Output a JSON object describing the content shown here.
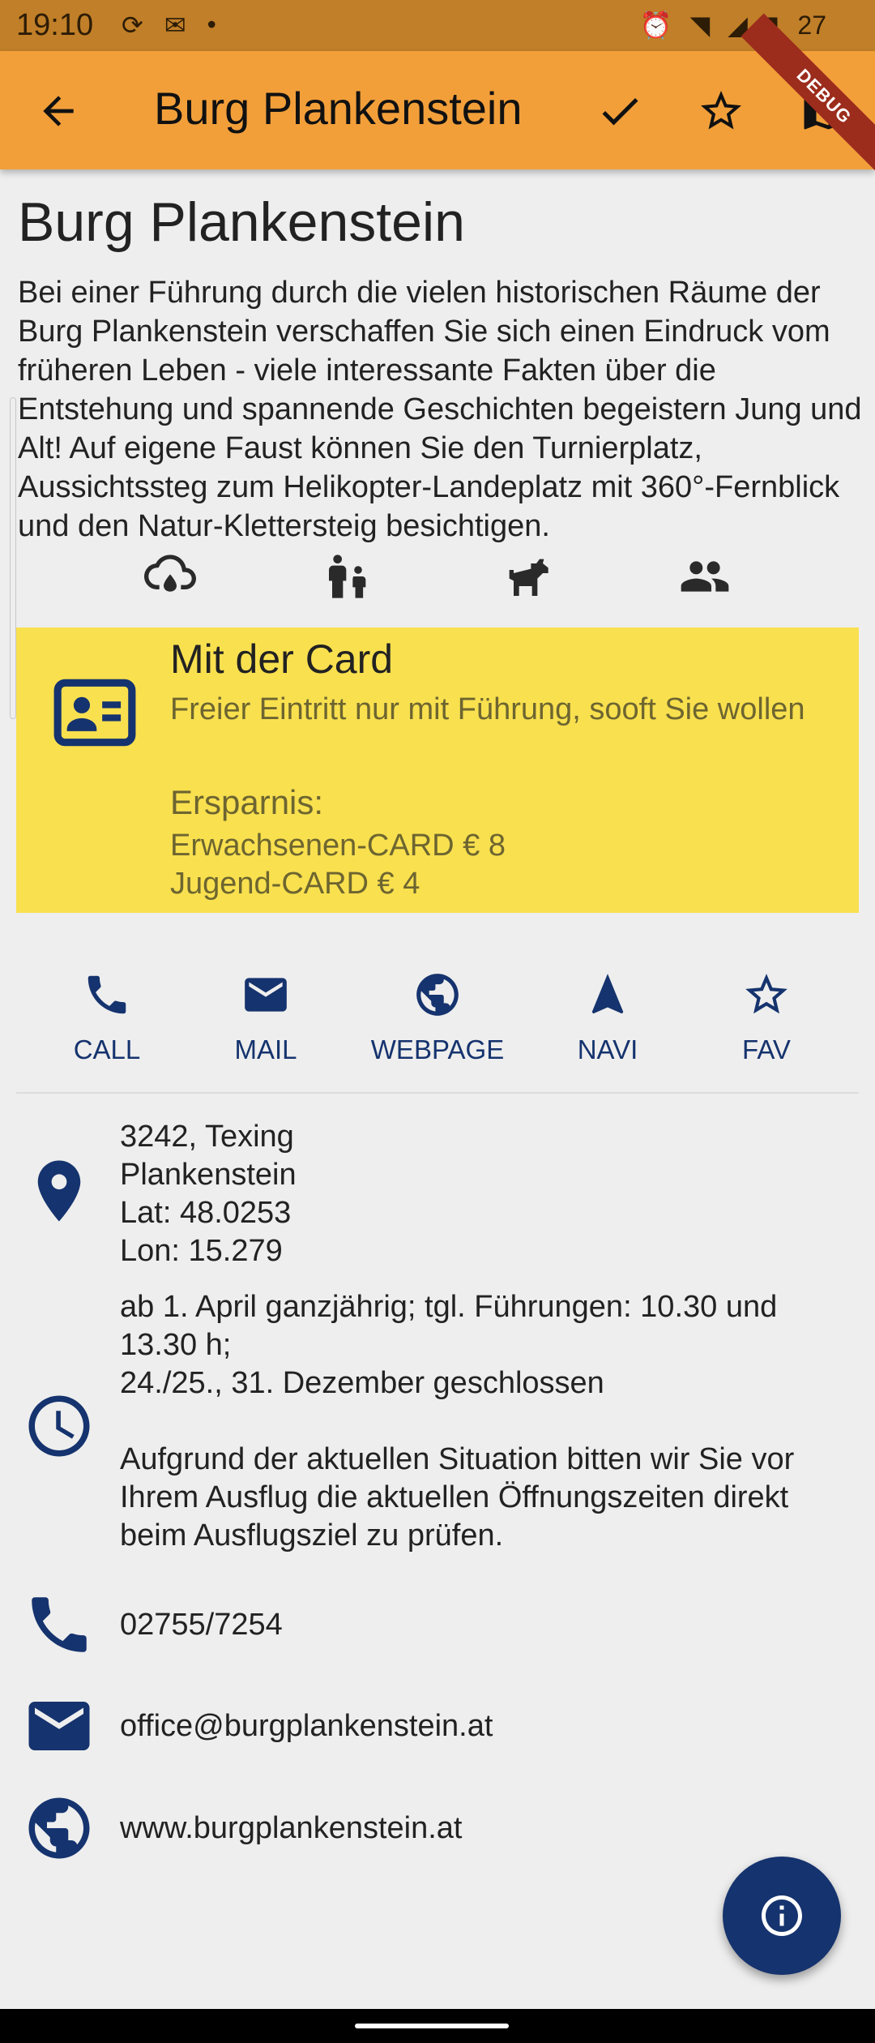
{
  "status_bar": {
    "time": "19:10",
    "battery": "27"
  },
  "app_bar": {
    "title": "Burg Plankenstein",
    "debug_label": "DEBUG"
  },
  "poi": {
    "title": "Burg Plankenstein",
    "description": "Bei einer Führung durch die vielen historischen Räume der Burg Plankenstein verschaffen Sie sich einen Eindruck vom früheren Leben - viele interessante Fakten über die Entstehung und spannende Geschichten begeistern Jung und Alt! Auf eigene Faust können Sie den Turnierplatz, Aussichtssteg zum Helikopter-Landeplatz mit 360°-Fernblick und den Natur-Klettersteig besichtigen.",
    "features": [
      "weather-icon",
      "family-icon",
      "dog-icon",
      "group-icon"
    ]
  },
  "card": {
    "title": "Mit der Card",
    "subtitle": "Freier Eintritt nur mit Führung, sooft Sie wollen",
    "savings_title": "Ersparnis:",
    "savings_lines": [
      "Erwachsenen-CARD € 8",
      "Jugend-CARD € 4"
    ]
  },
  "actions": [
    {
      "label": "CALL",
      "icon": "phone-icon"
    },
    {
      "label": "MAIL",
      "icon": "mail-icon"
    },
    {
      "label": "WEBPAGE",
      "icon": "globe-icon"
    },
    {
      "label": "NAVI",
      "icon": "navigation-icon"
    },
    {
      "label": "FAV",
      "icon": "star-icon"
    }
  ],
  "info": {
    "address": [
      "3242, Texing",
      "Plankenstein",
      "Lat: 48.0253",
      "Lon: 15.279"
    ],
    "hours": [
      "ab 1. April ganzjährig; tgl. Führungen: 10.30 und 13.30 h;",
      "24./25., 31. Dezember geschlossen",
      "",
      "Aufgrund der aktuellen Situation bitten wir Sie vor Ihrem Ausflug die aktuellen Öffnungszeiten direkt beim Ausflugsziel zu prüfen."
    ],
    "phone": "02755/7254",
    "email": "office@burgplankenstein.at",
    "website": "www.burgplankenstein.at"
  },
  "colors": {
    "accent": "#f29f3a",
    "primary": "#15336e",
    "card_bg": "#f9e04f",
    "background": "#eeeeee"
  }
}
